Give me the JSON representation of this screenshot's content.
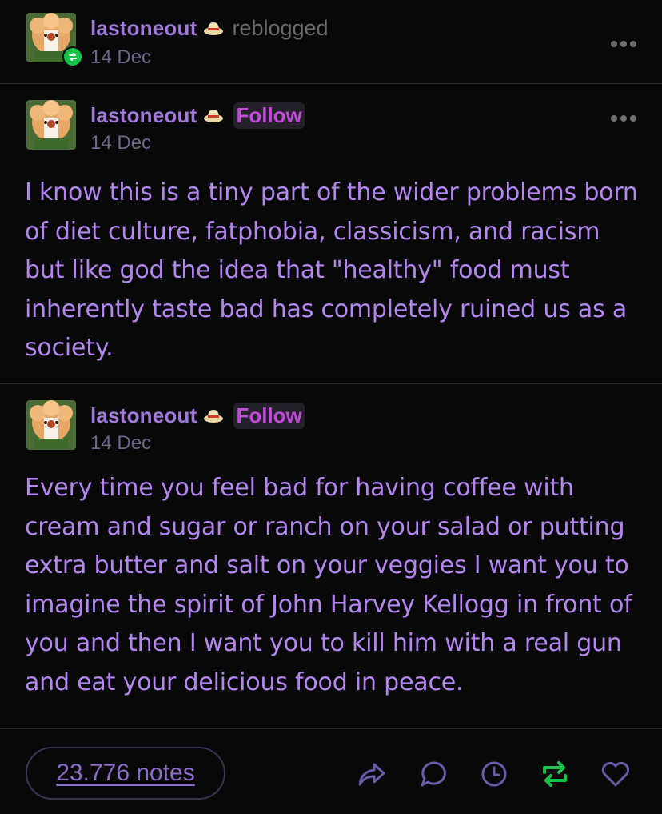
{
  "header": {
    "username": "lastoneout",
    "action_text": "reblogged",
    "date": "14 Dec"
  },
  "posts": [
    {
      "username": "lastoneout",
      "follow_label": "Follow",
      "date": "14 Dec",
      "text": "I know this is a tiny part of the wider problems born of diet culture, fatphobia, classicism, and racism but like god the idea that \"healthy\" food must inherently taste bad has completely ruined us as a society."
    },
    {
      "username": "lastoneout",
      "follow_label": "Follow",
      "date": "14 Dec",
      "text": "Every time you feel bad for having coffee with cream and sugar or ranch on your salad or putting extra butter and salt on your veggies I want you to imagine the spirit of John Harvey Kellogg in front of you and then I want you to kill him with a real gun and eat your delicious food in peace."
    }
  ],
  "footer": {
    "notes_label": "23.776 notes",
    "actions": [
      "share-icon",
      "reply-icon",
      "schedule-icon",
      "reblog-icon",
      "like-icon"
    ]
  },
  "colors": {
    "background": "#080808",
    "text": "#b486f0",
    "username": "#a07ad8",
    "follow": "#c24ad9",
    "reblog_active": "#14c448"
  }
}
